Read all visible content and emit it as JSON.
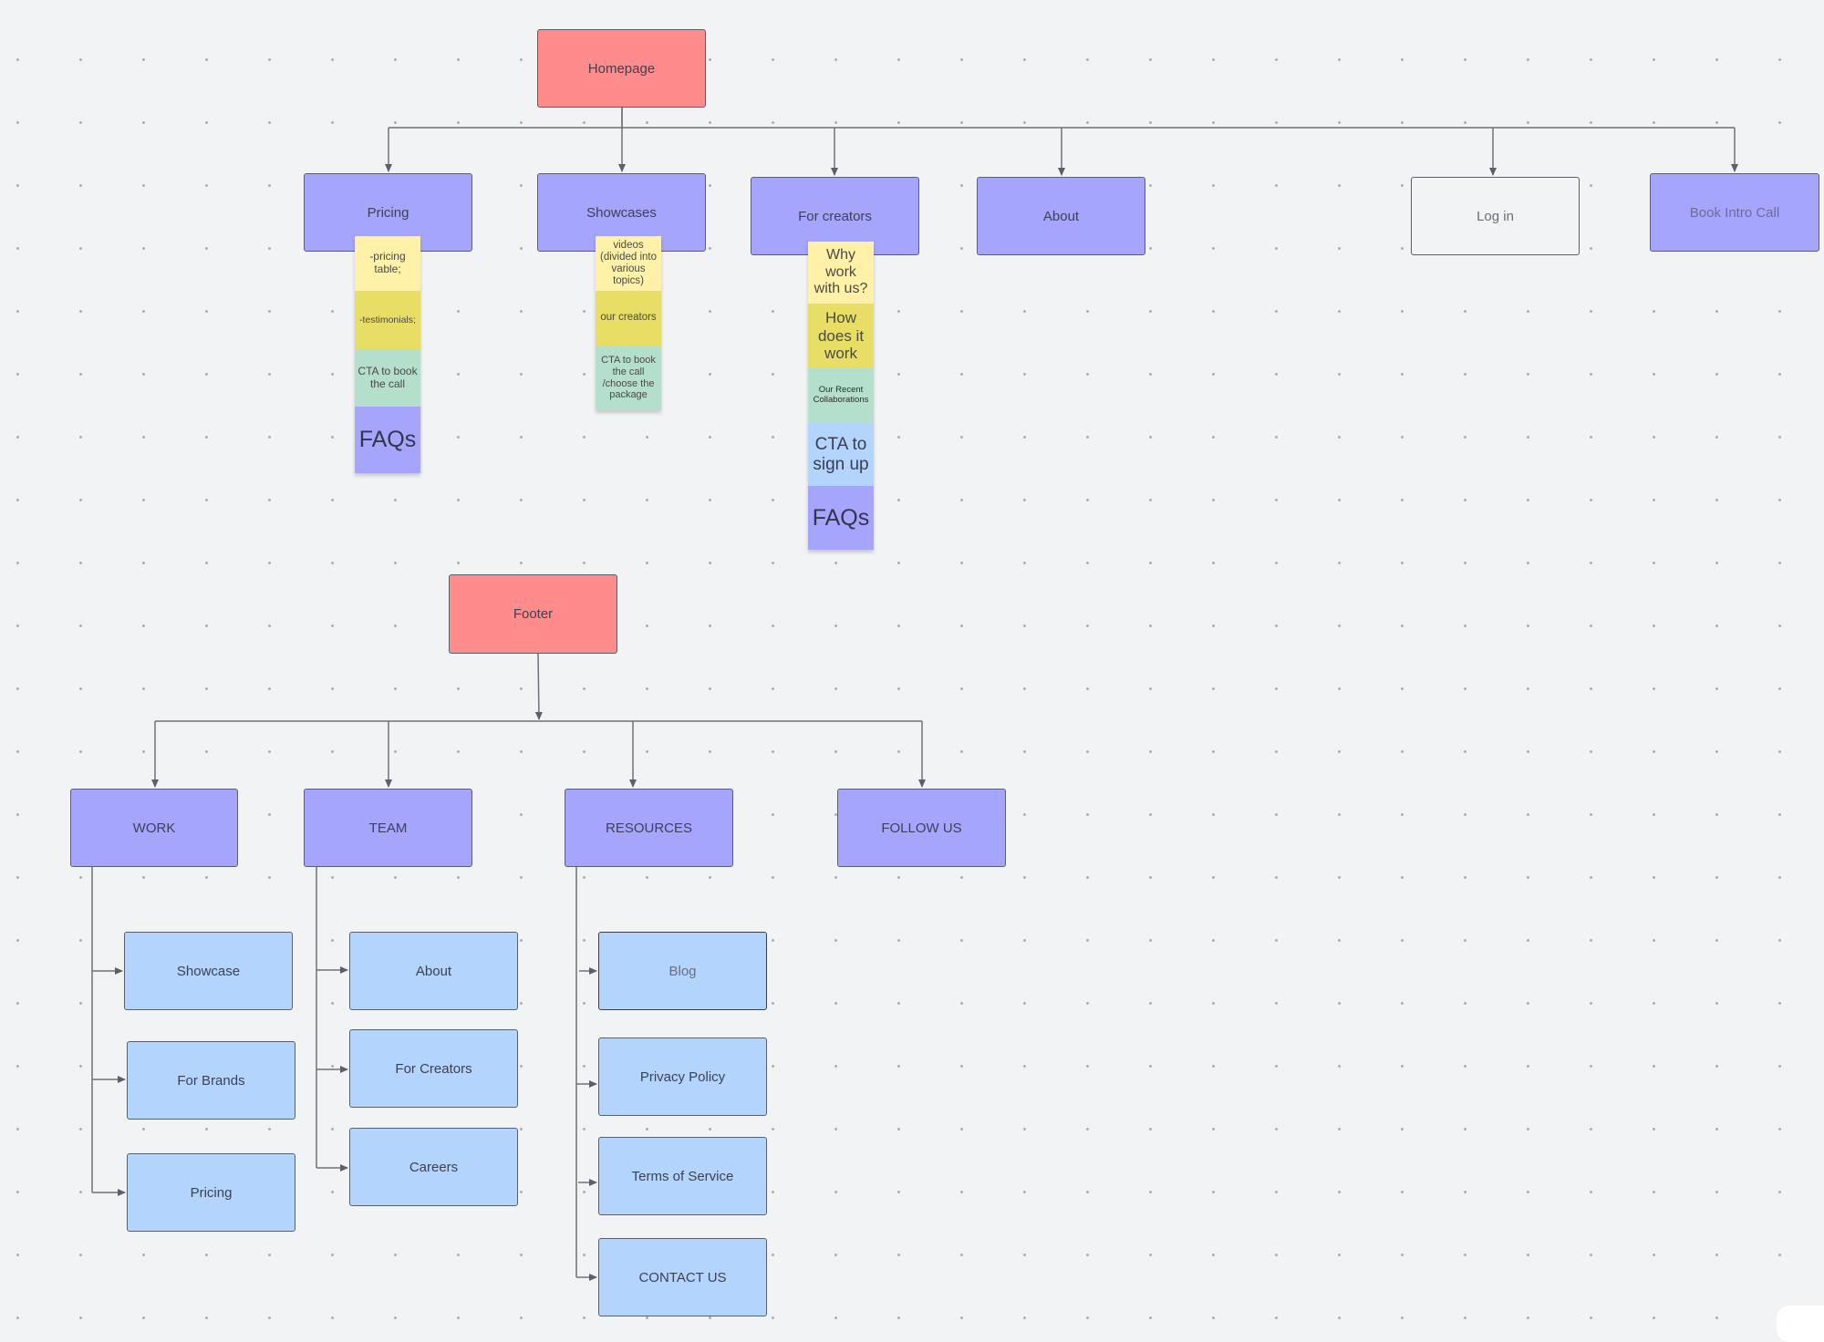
{
  "homepage": {
    "root": "Homepage",
    "children": [
      {
        "label": "Pricing",
        "notes": [
          "-pricing table;",
          "-testimonials;",
          "CTA to book the call",
          "FAQs"
        ]
      },
      {
        "label": "Showcases",
        "notes": [
          "videos (divided into various topics)",
          "our creators",
          "CTA to book the call /choose the package"
        ]
      },
      {
        "label": "For creators",
        "notes": [
          "Why work with us?",
          "How does it work",
          "Our Recent Collaborations",
          "CTA to sign up",
          "FAQs"
        ]
      },
      {
        "label": "About"
      },
      {
        "label": "Log in"
      },
      {
        "label": "Book Intro Call"
      }
    ]
  },
  "footer": {
    "root": "Footer",
    "groups": [
      {
        "label": "WORK",
        "items": [
          "Showcase",
          "For Brands",
          "Pricing"
        ]
      },
      {
        "label": "TEAM",
        "items": [
          "About",
          "For Creators",
          "Careers"
        ]
      },
      {
        "label": "RESOURCES",
        "items": [
          "Blog",
          "Privacy Policy",
          "Terms of Service",
          "CONTACT US"
        ]
      },
      {
        "label": "FOLLOW US"
      }
    ]
  },
  "colors": {
    "root": "#ff8c8c",
    "section": "#a5a5fd",
    "subpage": "#b3d4fd",
    "sticky_yellow": "#fff1a8",
    "sticky_olive": "#e8de66",
    "sticky_green": "#b4dfca",
    "sticky_blue": "#b3d4fd",
    "sticky_purple": "#a5a5fd"
  }
}
